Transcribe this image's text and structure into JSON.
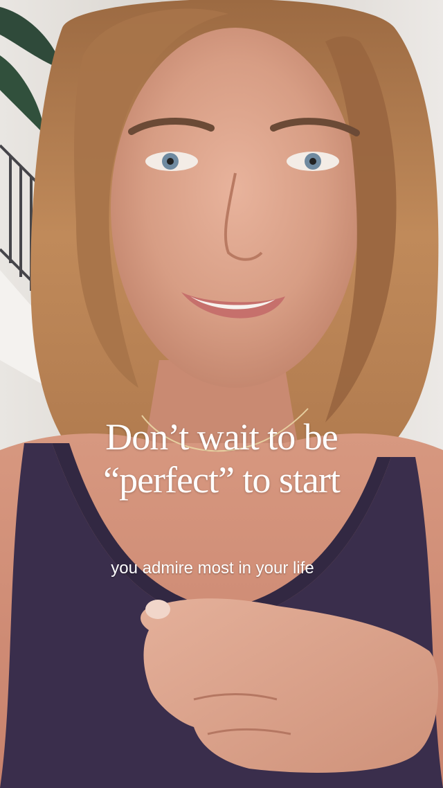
{
  "video": {
    "overlay_title_line1": "Don’t wait to be",
    "overlay_title_line2": "“perfect” to start",
    "subtitle": "you admire most in your life"
  },
  "colors": {
    "overlay_text": "#ffffff",
    "top": "#3a2e4c",
    "skin": "#d79d84",
    "hair": "#b07a4e"
  }
}
